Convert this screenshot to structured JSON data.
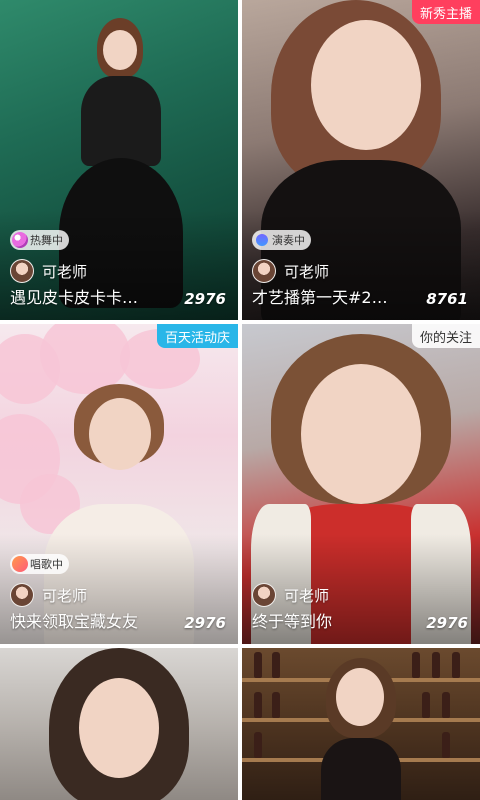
{
  "cards": [
    {
      "corner_tag": "",
      "status": "热舞中",
      "status_icon": "dance-icon",
      "host": "可老师",
      "title": "遇见皮卡皮卡卡…",
      "count": "2976"
    },
    {
      "corner_tag": "新秀主播",
      "corner_tag_color": "#ff3f5e",
      "status": "演奏中",
      "status_icon": "instrument-icon",
      "host": "可老师",
      "title": "才艺播第一天#2…",
      "count": "8761"
    },
    {
      "corner_tag": "百天活动庆",
      "corner_tag_color": "#29b6e8",
      "status": "唱歌中",
      "status_icon": "microphone-icon",
      "host": "可老师",
      "title": "快来领取宝藏女友",
      "count": "2976"
    },
    {
      "corner_tag": "你的关注",
      "status": "",
      "host": "可老师",
      "title": "终于等到你",
      "count": "2976"
    },
    {
      "corner_tag": "",
      "status": "",
      "host": "",
      "title": "",
      "count": ""
    },
    {
      "corner_tag": "",
      "status": "",
      "host": "",
      "title": "",
      "count": ""
    }
  ]
}
